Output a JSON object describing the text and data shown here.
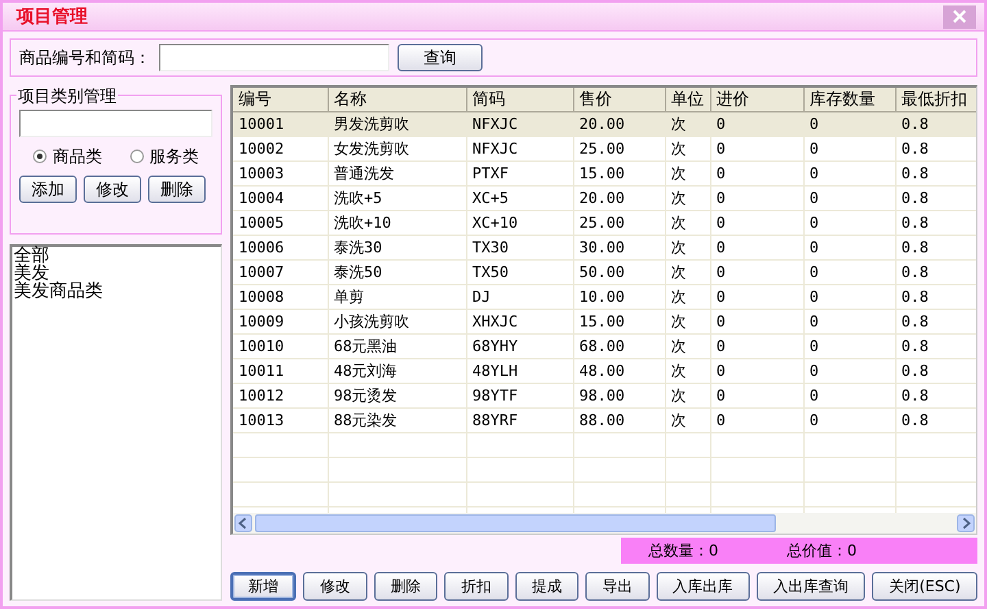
{
  "window": {
    "title": "项目管理"
  },
  "search": {
    "label": "商品编号和简码：",
    "button": "查询"
  },
  "category_group": {
    "title": "项目类别管理",
    "radios": [
      {
        "label": "商品类",
        "selected": true
      },
      {
        "label": "服务类",
        "selected": false
      }
    ],
    "buttons": [
      "添加",
      "修改",
      "删除"
    ],
    "items": [
      {
        "label": "全部",
        "selected": false
      },
      {
        "label": "美发",
        "selected": false
      },
      {
        "label": "美发商品类",
        "selected": false
      }
    ]
  },
  "table": {
    "columns": [
      "编号",
      "名称",
      "简码",
      "售价",
      "单位",
      "进价",
      "库存数量",
      "最低折扣"
    ],
    "rows": [
      {
        "selected": true,
        "cells": [
          "10001",
          "男发洗剪吹",
          "NFXJC",
          "20.00",
          "次",
          "0",
          "0",
          "0.8"
        ]
      },
      {
        "selected": false,
        "cells": [
          "10002",
          "女发洗剪吹",
          "NFXJC",
          "25.00",
          "次",
          "0",
          "0",
          "0.8"
        ]
      },
      {
        "selected": false,
        "cells": [
          "10003",
          "普通洗发",
          "PTXF",
          "15.00",
          "次",
          "0",
          "0",
          "0.8"
        ]
      },
      {
        "selected": false,
        "cells": [
          "10004",
          "洗吹+5",
          "XC+5",
          "20.00",
          "次",
          "0",
          "0",
          "0.8"
        ]
      },
      {
        "selected": false,
        "cells": [
          "10005",
          "洗吹+10",
          "XC+10",
          "25.00",
          "次",
          "0",
          "0",
          "0.8"
        ]
      },
      {
        "selected": false,
        "cells": [
          "10006",
          "泰洗30",
          "TX30",
          "30.00",
          "次",
          "0",
          "0",
          "0.8"
        ]
      },
      {
        "selected": false,
        "cells": [
          "10007",
          "泰洗50",
          "TX50",
          "50.00",
          "次",
          "0",
          "0",
          "0.8"
        ]
      },
      {
        "selected": false,
        "cells": [
          "10008",
          "单剪",
          "DJ",
          "10.00",
          "次",
          "0",
          "0",
          "0.8"
        ]
      },
      {
        "selected": false,
        "cells": [
          "10009",
          "小孩洗剪吹",
          "XHXJC",
          "15.00",
          "次",
          "0",
          "0",
          "0.8"
        ]
      },
      {
        "selected": false,
        "cells": [
          "10010",
          "68元黑油",
          "68YHY",
          "68.00",
          "次",
          "0",
          "0",
          "0.8"
        ]
      },
      {
        "selected": false,
        "cells": [
          "10011",
          "48元刘海",
          "48YLH",
          "48.00",
          "次",
          "0",
          "0",
          "0.8"
        ]
      },
      {
        "selected": false,
        "cells": [
          "10012",
          "98元烫发",
          "98YTF",
          "98.00",
          "次",
          "0",
          "0",
          "0.8"
        ]
      },
      {
        "selected": false,
        "cells": [
          "10013",
          "88元染发",
          "88YRF",
          "88.00",
          "次",
          "0",
          "0",
          "0.8"
        ]
      }
    ]
  },
  "summary": {
    "total_quantity": "总数量：0",
    "total_value": "总价值：0"
  },
  "buttons": [
    {
      "label": "新增",
      "focused": true
    },
    {
      "label": "修改",
      "focused": false
    },
    {
      "label": "删除",
      "focused": false
    },
    {
      "label": "折扣",
      "focused": false
    },
    {
      "label": "提成",
      "focused": false
    },
    {
      "label": "导出",
      "focused": false
    },
    {
      "label": "入库出库",
      "focused": false
    },
    {
      "label": "入出库查询",
      "focused": false
    },
    {
      "label": "关闭(ESC)",
      "focused": false
    }
  ]
}
